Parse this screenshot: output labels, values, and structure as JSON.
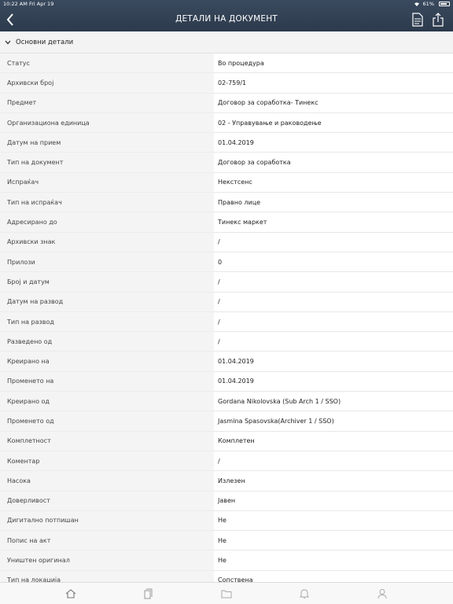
{
  "status_bar": {
    "time": "10:22 AM",
    "date": "Fri Apr 19",
    "battery": "61%"
  },
  "header": {
    "title": "ДЕТАЛИ НА ДОКУМЕНТ"
  },
  "section": {
    "label": "Основни детали"
  },
  "rows": [
    {
      "label": "Статус",
      "value": "Во процедура"
    },
    {
      "label": "Архивски број",
      "value": "02-759/1"
    },
    {
      "label": "Предмет",
      "value": "Договор за соработка- Тинекс"
    },
    {
      "label": "Организациона единица",
      "value": "02 - Управување и раководење"
    },
    {
      "label": "Датум на прием",
      "value": "01.04.2019"
    },
    {
      "label": "Тип на документ",
      "value": "Договор за соработка"
    },
    {
      "label": "Испраќач",
      "value": "Некстсенс"
    },
    {
      "label": "Тип на испраќач",
      "value": "Правно лице"
    },
    {
      "label": "Адресирано до",
      "value": "Тинекс маркет"
    },
    {
      "label": "Архивски знак",
      "value": "/"
    },
    {
      "label": "Прилози",
      "value": "0"
    },
    {
      "label": "Број и датум",
      "value": "/"
    },
    {
      "label": "Датум на развод",
      "value": "/"
    },
    {
      "label": "Тип на развод",
      "value": "/"
    },
    {
      "label": "Разведено од",
      "value": "/"
    },
    {
      "label": "Креирано на",
      "value": "01.04.2019"
    },
    {
      "label": "Променето на",
      "value": "01.04.2019"
    },
    {
      "label": "Креирано од",
      "value": "Gordana Nikolovska (Sub Arch 1 / SSO)"
    },
    {
      "label": "Променето од",
      "value": "Jasmina Spasovska(Archiver 1 / SSO)"
    },
    {
      "label": "Комплетност",
      "value": "Комплетен"
    },
    {
      "label": "Коментар",
      "value": "/"
    },
    {
      "label": "Насока",
      "value": "Излезен"
    },
    {
      "label": "Доверливост",
      "value": "Јавен"
    },
    {
      "label": "Дигитално потпишан",
      "value": "Не"
    },
    {
      "label": "Попис на акт",
      "value": "Не"
    },
    {
      "label": "Уништен оригинал",
      "value": "Не"
    },
    {
      "label": "Тип на локација",
      "value": "Сопствена"
    }
  ],
  "tabbar": {
    "items": [
      {
        "icon": "home-icon"
      },
      {
        "icon": "documents-icon"
      },
      {
        "icon": "folder-icon"
      },
      {
        "icon": "bell-icon"
      },
      {
        "icon": "user-icon"
      }
    ]
  },
  "colors": {
    "header_bg": "#2f3d50",
    "section_bg": "#f3f3f3",
    "key_bg": "#f4f4f4"
  }
}
